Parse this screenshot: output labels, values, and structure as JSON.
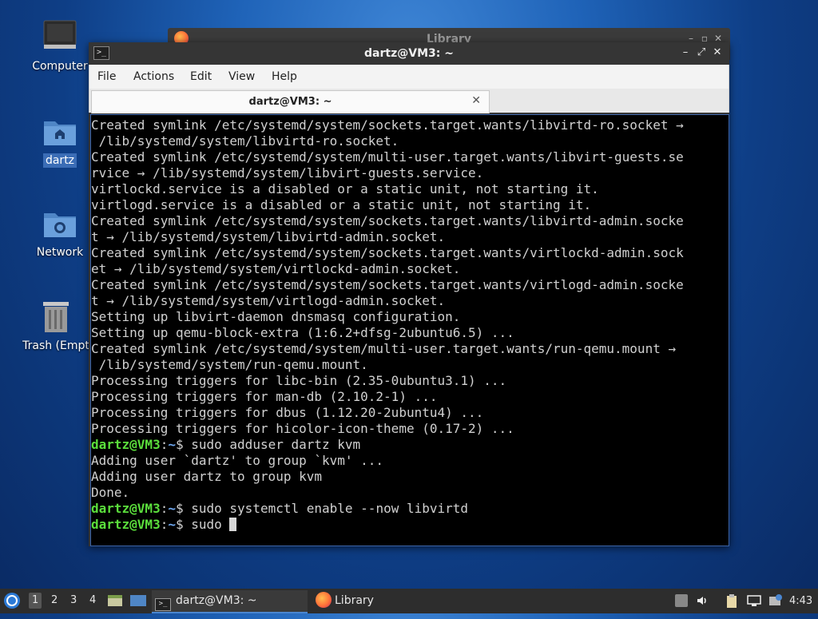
{
  "desktop": {
    "icons": [
      {
        "label": "Computer"
      },
      {
        "label": "dartz"
      },
      {
        "label": "Network"
      },
      {
        "label": "Trash (Empt"
      }
    ]
  },
  "back_window": {
    "title": "Library"
  },
  "terminal_window": {
    "title": "dartz@VM3: ~",
    "menu": [
      "File",
      "Edit",
      "View",
      "Help"
    ],
    "menu_items": {
      "file": "File",
      "actions": "Actions",
      "edit": "Edit",
      "view": "View",
      "help": "Help"
    },
    "tab_label": "dartz@VM3: ~",
    "output_lines": [
      "Created symlink /etc/systemd/system/sockets.target.wants/libvirtd-ro.socket →",
      " /lib/systemd/system/libvirtd-ro.socket.",
      "Created symlink /etc/systemd/system/multi-user.target.wants/libvirt-guests.se",
      "rvice → /lib/systemd/system/libvirt-guests.service.",
      "virtlockd.service is a disabled or a static unit, not starting it.",
      "virtlogd.service is a disabled or a static unit, not starting it.",
      "Created symlink /etc/systemd/system/sockets.target.wants/libvirtd-admin.socke",
      "t → /lib/systemd/system/libvirtd-admin.socket.",
      "Created symlink /etc/systemd/system/sockets.target.wants/virtlockd-admin.sock",
      "et → /lib/systemd/system/virtlockd-admin.socket.",
      "Created symlink /etc/systemd/system/sockets.target.wants/virtlogd-admin.socke",
      "t → /lib/systemd/system/virtlogd-admin.socket.",
      "Setting up libvirt-daemon dnsmasq configuration.",
      "Setting up qemu-block-extra (1:6.2+dfsg-2ubuntu6.5) ...",
      "Created symlink /etc/systemd/system/multi-user.target.wants/run-qemu.mount →",
      " /lib/systemd/system/run-qemu.mount.",
      "Processing triggers for libc-bin (2.35-0ubuntu3.1) ...",
      "Processing triggers for man-db (2.10.2-1) ...",
      "Processing triggers for dbus (1.12.20-2ubuntu4) ...",
      "Processing triggers for hicolor-icon-theme (0.17-2) ..."
    ],
    "prompt_user": "dartz@VM3",
    "prompt_sep": ":",
    "prompt_path": "~",
    "prompt_end": "$ ",
    "cmd1": "sudo adduser dartz kvm",
    "cmd1_output": [
      "Adding user `dartz' to group `kvm' ...",
      "Adding user dartz to group kvm",
      "Done."
    ],
    "cmd2": "sudo systemctl enable --now libvirtd",
    "cmd3": "sudo "
  },
  "taskbar": {
    "workspaces": [
      "1",
      "2",
      "3",
      "4"
    ],
    "tasks": [
      {
        "label": "dartz@VM3: ~"
      },
      {
        "label": "Library"
      }
    ],
    "clock": "4:43"
  }
}
